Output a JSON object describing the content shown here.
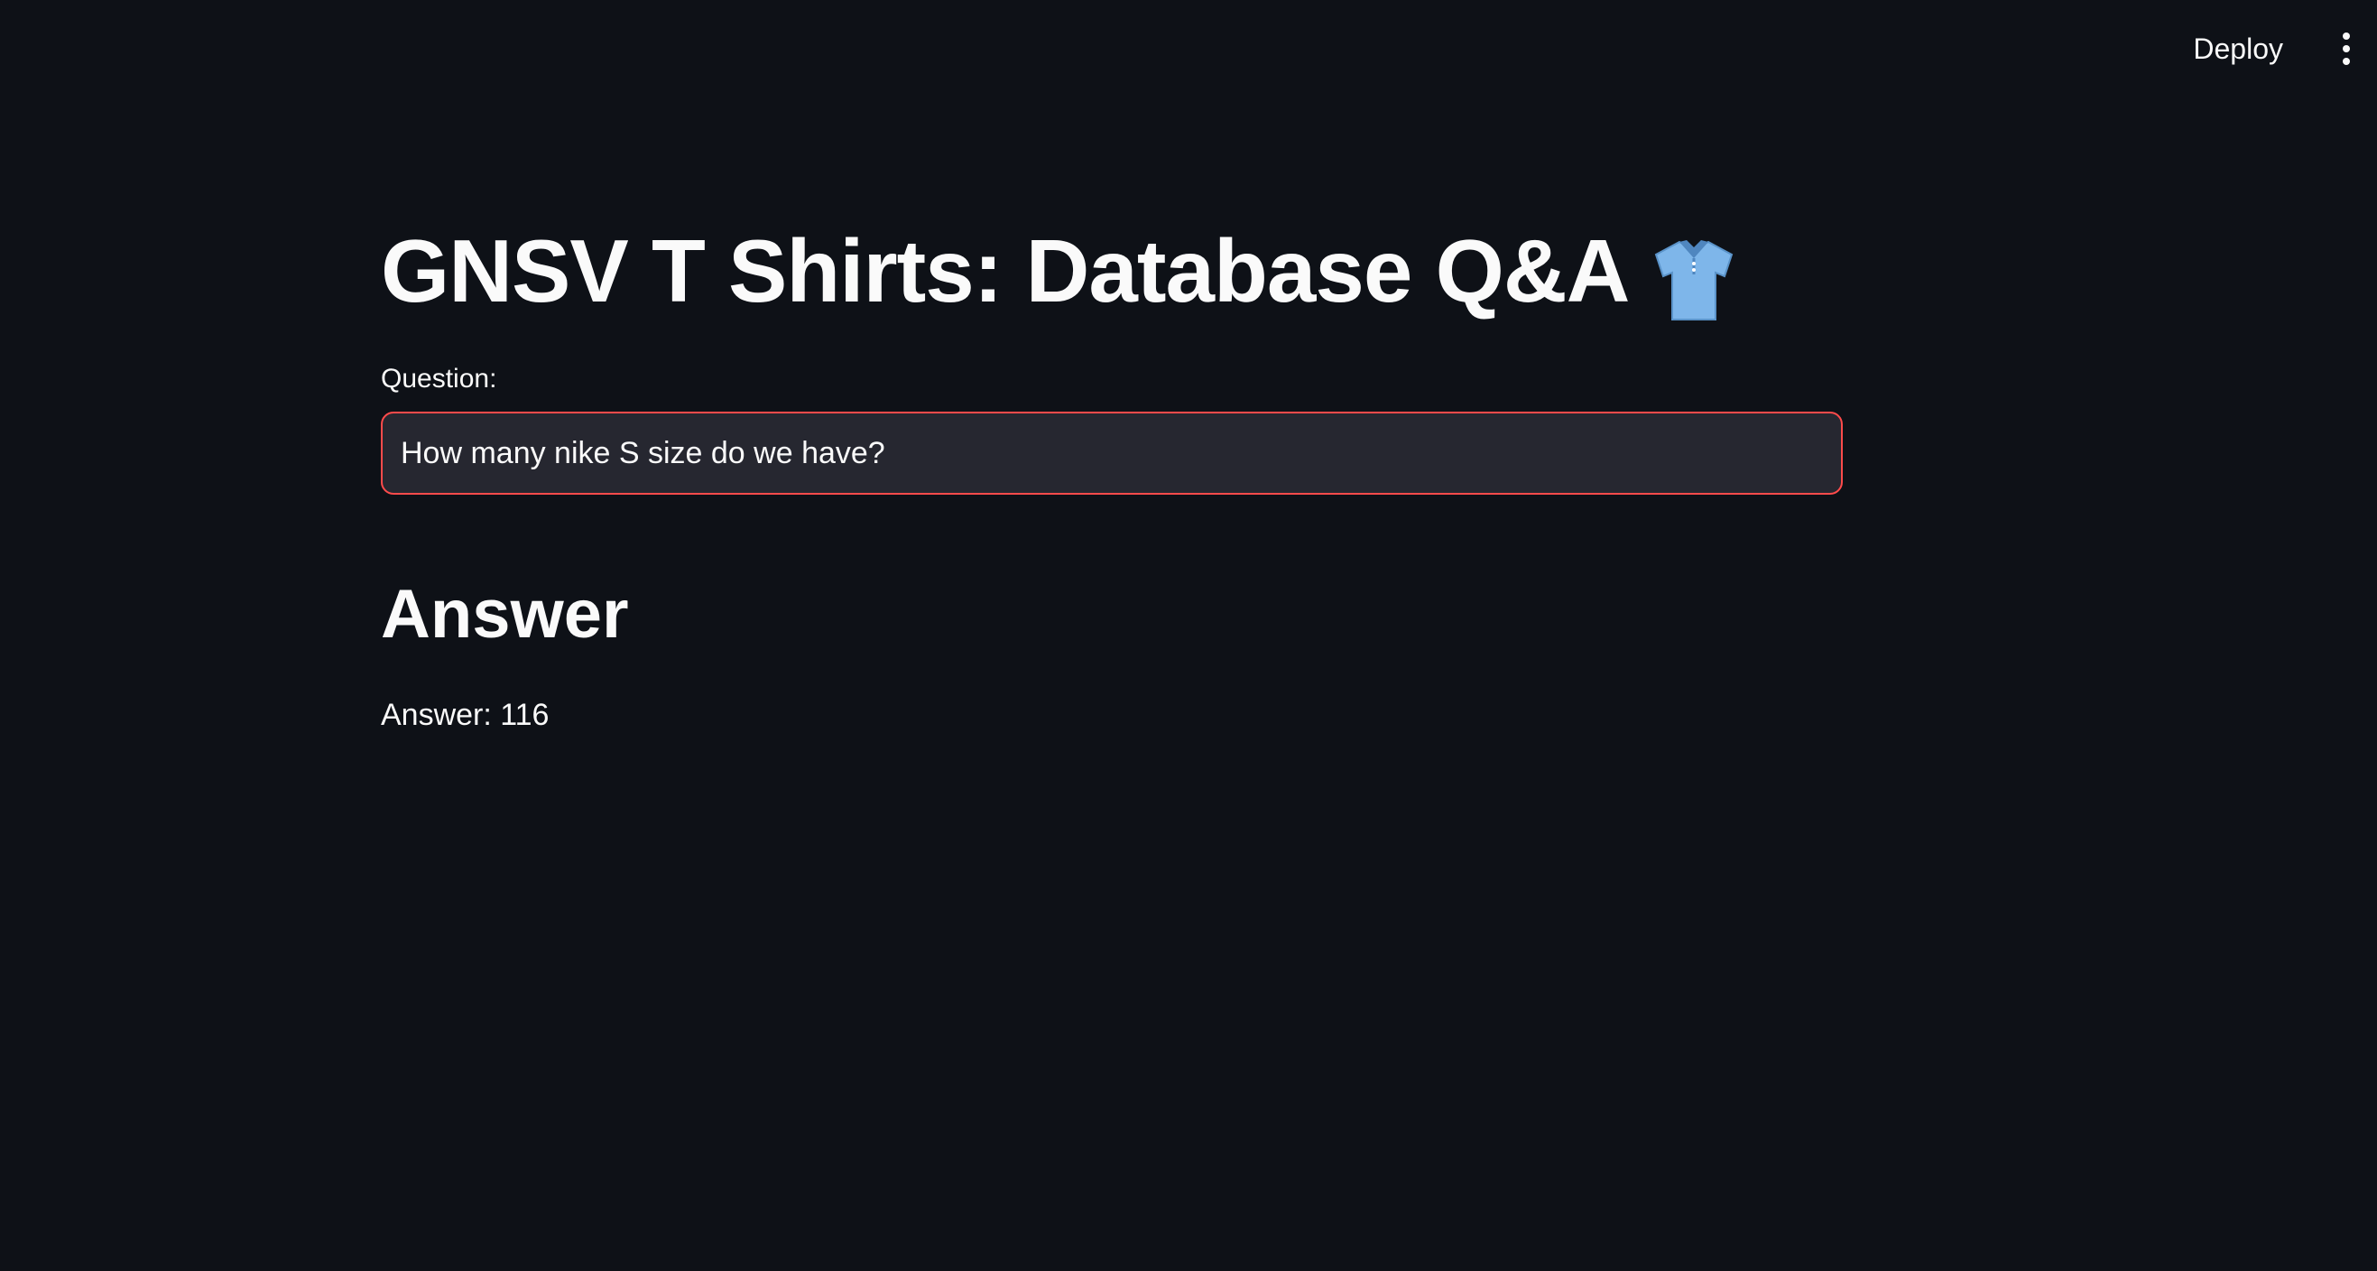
{
  "toolbar": {
    "deploy_label": "Deploy",
    "menu_icon": "vertical-dots-icon"
  },
  "main": {
    "title": "GNSV T Shirts: Database Q&A",
    "title_icon": "shirt-icon",
    "question_label": "Question:",
    "question_value": "How many nike S size do we have?",
    "answer_heading": "Answer",
    "answer_text": "Answer: 116"
  },
  "colors": {
    "background": "#0e1117",
    "input_background": "#262730",
    "input_focus_border": "#ff4b4b",
    "text": "#fafafa",
    "shirt": "#7eb6ea"
  }
}
